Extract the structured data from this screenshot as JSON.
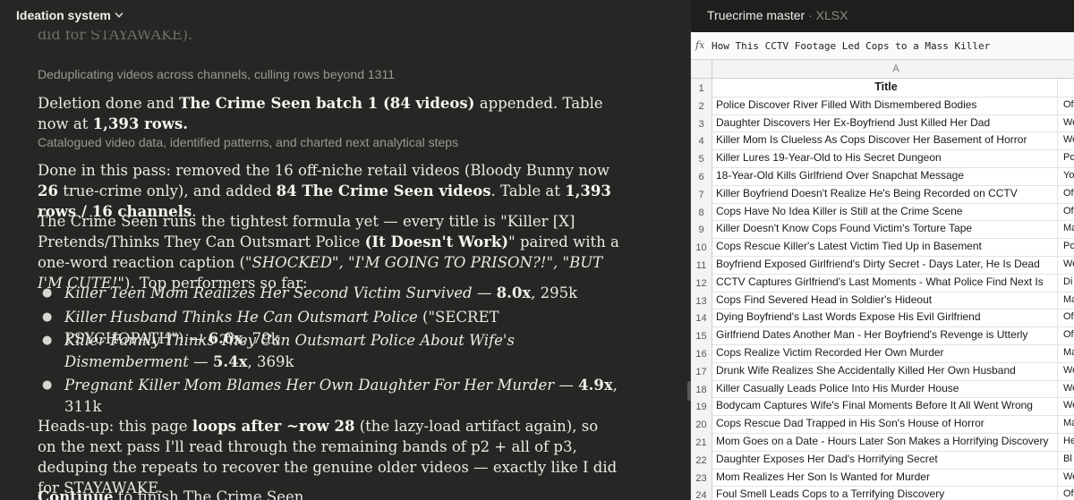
{
  "app": {
    "title": "Ideation system"
  },
  "chat": {
    "cutoff_text": "did for STAYAWAKE).",
    "step1": "Deduplicating videos across channels, culling rows beyond 1311",
    "msg1": {
      "t1": "Deletion done and ",
      "b1": "The Crime Seen batch 1 (84 videos)",
      "t2": " appended. Table now at ",
      "b2": "1,393 rows.",
      "t3": ""
    },
    "step2": "Catalogued video data, identified patterns, and charted next analytical steps",
    "msg2": {
      "t1": "Done in this pass: removed the 16 off-niche retail videos (Bloody Bunny now ",
      "b1": "26",
      "t2": " true-crime only), and added ",
      "b2": "84 The Crime Seen videos",
      "t3": ". Table at ",
      "b3": "1,393 rows / 16 channels",
      "t4": "."
    },
    "msg3": {
      "t1": "The Crime Seen runs the tightest formula yet — every title is \"Killer [X] Pretends/Thinks They Can Outsmart Police ",
      "b1": "(It Doesn't Work)",
      "t2": "\" paired with a one-word reaction caption (",
      "i1": "\"SHOCKED\", \"I'M GOING TO PRISON?!\", \"BUT I'M CUTE!\"",
      "t3": "). Top performers so far:"
    },
    "performers": [
      {
        "title": "Killer Teen Mom Realizes Her Second Victim Survived",
        "note": "",
        "mult": "8.0x",
        "views": ", 295k"
      },
      {
        "title": "Killer Husband Thinks He Can Outsmart Police",
        "note": " (\"SECRET PSYCHOPATH\")",
        "mult": "6.6x",
        "views": ", 79k"
      },
      {
        "title": "Killer Family Thinks They Can Outsmart Police About Wife's Dismemberment",
        "note": "",
        "mult": "5.4x",
        "views": ", 369k"
      },
      {
        "title": "Pregnant Killer Mom Blames Her Own Daughter For Her Murder",
        "note": "",
        "mult": "4.9x",
        "views": ", 311k"
      }
    ],
    "msg4": {
      "t1": "Heads-up: this page ",
      "b1": "loops after ~row 28",
      "t2": " (the lazy-load artifact again), so on the next pass I'll read through the remaining bands of p2 + all of p3, deduping the repeats to recover the genuine older videos — exactly like I did for STAYAWAKE."
    },
    "msg5": {
      "b1": "Continue",
      "t1": " to finish The Crime Seen"
    }
  },
  "artifact": {
    "title": "Truecrime master",
    "separator": "·",
    "type": "XLSX",
    "fx_label": "fx",
    "formula": "How This CCTV Footage Led Cops to a Mass Killer",
    "column_letter": "A",
    "rows": [
      {
        "n": "1",
        "title": "Title",
        "b": ""
      },
      {
        "n": "2",
        "title": "Police Discover River Filled With Dismembered Bodies",
        "b": "Of"
      },
      {
        "n": "3",
        "title": "Daughter Discovers Her Ex-Boyfriend Just Killed Her Dad",
        "b": "We"
      },
      {
        "n": "4",
        "title": "Killer Mom Is Clueless As Cops Discover Her Basement of Horror",
        "b": "We"
      },
      {
        "n": "5",
        "title": "Killer Lures 19-Year-Old to His Secret Dungeon",
        "b": "Po"
      },
      {
        "n": "6",
        "title": "18-Year-Old Kills Girlfriend Over Snapchat Message",
        "b": "Yo"
      },
      {
        "n": "7",
        "title": "Killer Boyfriend Doesn't Realize He's Being Recorded on CCTV",
        "b": "Of"
      },
      {
        "n": "8",
        "title": "Cops Have No Idea Killer is Still at the Crime Scene",
        "b": "Of"
      },
      {
        "n": "9",
        "title": "Killer Doesn't Know Cops Found Victim's Torture Tape",
        "b": "Ma"
      },
      {
        "n": "10",
        "title": "Cops Rescue Killer's Latest Victim Tied Up in Basement",
        "b": "Po"
      },
      {
        "n": "11",
        "title": "Boyfriend Exposed Girlfriend's Dirty Secret - Days Later, He Is Dead",
        "b": "We"
      },
      {
        "n": "12",
        "title": "CCTV Captures Girlfriend's Last Moments - What Police Find Next Is",
        "b": "Di"
      },
      {
        "n": "13",
        "title": "Cops Find Severed Head in Soldier's Hideout",
        "b": "Ma"
      },
      {
        "n": "14",
        "title": "Dying Boyfriend's Last Words Expose His Evil Girlfriend",
        "b": "Of"
      },
      {
        "n": "15",
        "title": "Girlfriend Dates Another Man - Her Boyfriend's Revenge is Utterly",
        "b": "Of"
      },
      {
        "n": "16",
        "title": "Cops Realize Victim Recorded Her Own Murder",
        "b": "Ma"
      },
      {
        "n": "17",
        "title": "Drunk Wife Realizes She Accidentally Killed Her Own Husband",
        "b": "We"
      },
      {
        "n": "18",
        "title": "Killer Casually Leads Police Into His Murder House",
        "b": "We"
      },
      {
        "n": "19",
        "title": "Bodycam Captures Wife's Final Moments Before It All Went Wrong",
        "b": "We"
      },
      {
        "n": "20",
        "title": "Cops Rescue Dad Trapped in His Son's House of Horror",
        "b": "Ma"
      },
      {
        "n": "21",
        "title": "Mom Goes on a Date - Hours Later Son Makes a Horrifying Discovery",
        "b": "He"
      },
      {
        "n": "22",
        "title": "Daughter Exposes Her Dad's Horrifying Secret",
        "b": "Bl"
      },
      {
        "n": "23",
        "title": "Mom Realizes Her Son Is Wanted for Murder",
        "b": "We"
      },
      {
        "n": "24",
        "title": "Foul Smell Leads Cops to a Terrifying Discovery",
        "b": "Of"
      }
    ]
  }
}
